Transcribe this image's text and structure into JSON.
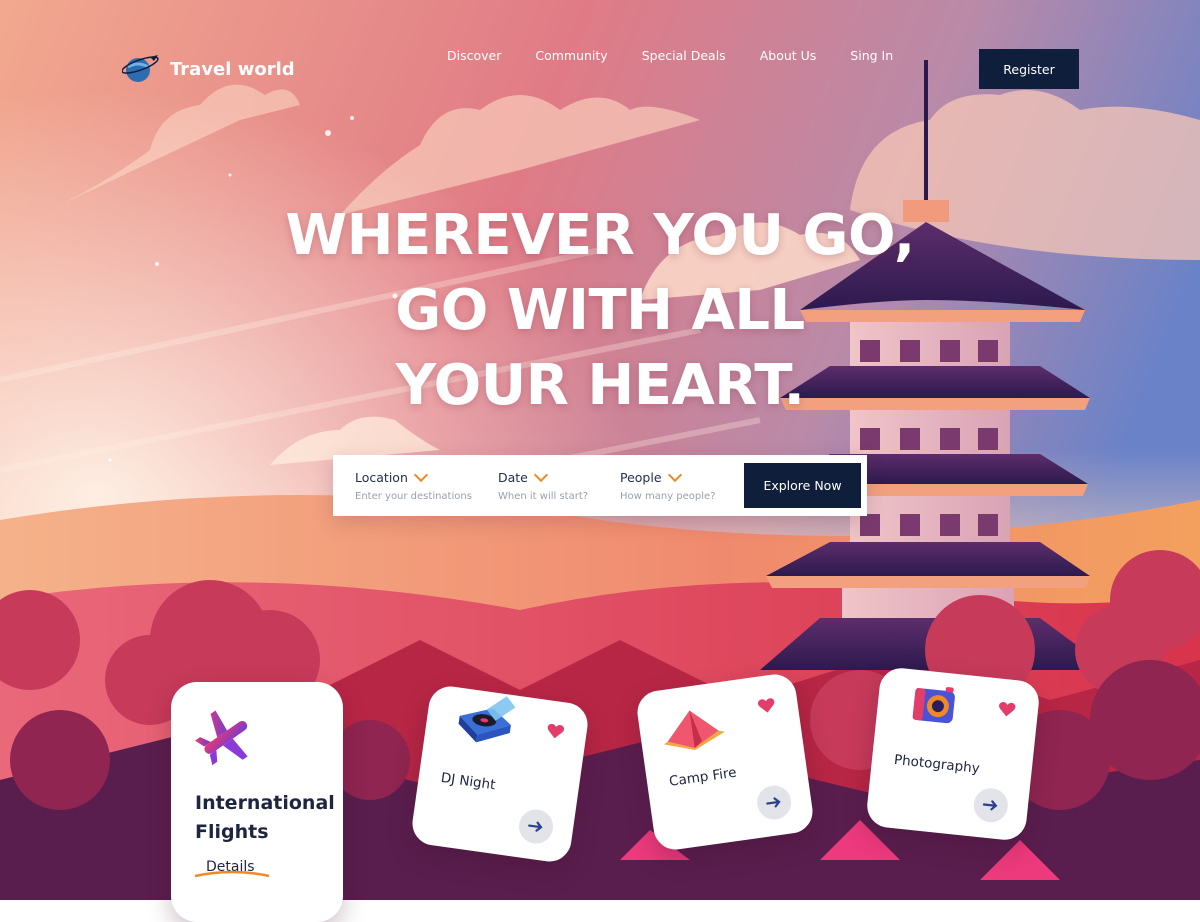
{
  "brand": {
    "name": "Travel world"
  },
  "nav": {
    "links": [
      "Discover",
      "Community",
      "Special Deals",
      "About Us",
      "Sing In"
    ],
    "register_label": "Register"
  },
  "hero": {
    "headline_lines": [
      "WHEREVER YOU GO,",
      "GO WITH ALL",
      "YOUR HEART."
    ]
  },
  "search": {
    "fields": [
      {
        "label": "Location",
        "placeholder": "Enter your destinations"
      },
      {
        "label": "Date",
        "placeholder": "When it will start?"
      },
      {
        "label": "People",
        "placeholder": "How many people?"
      }
    ],
    "button_label": "Explore Now"
  },
  "featured_card": {
    "title_lines": [
      "International",
      "Flights"
    ],
    "link_label": "Details",
    "icon": "airplane-icon"
  },
  "activity_cards": [
    {
      "label": "DJ Night",
      "icon": "turntable-icon"
    },
    {
      "label": "Camp Fire",
      "icon": "tent-icon"
    },
    {
      "label": "Photography",
      "icon": "camera-icon"
    }
  ],
  "colors": {
    "navy": "#0f1e3a",
    "accent_orange": "#f08a24",
    "heart_pink": "#e23e6a",
    "sky_top_right": "#6b82c9",
    "sky_left": "#f0a48c"
  }
}
